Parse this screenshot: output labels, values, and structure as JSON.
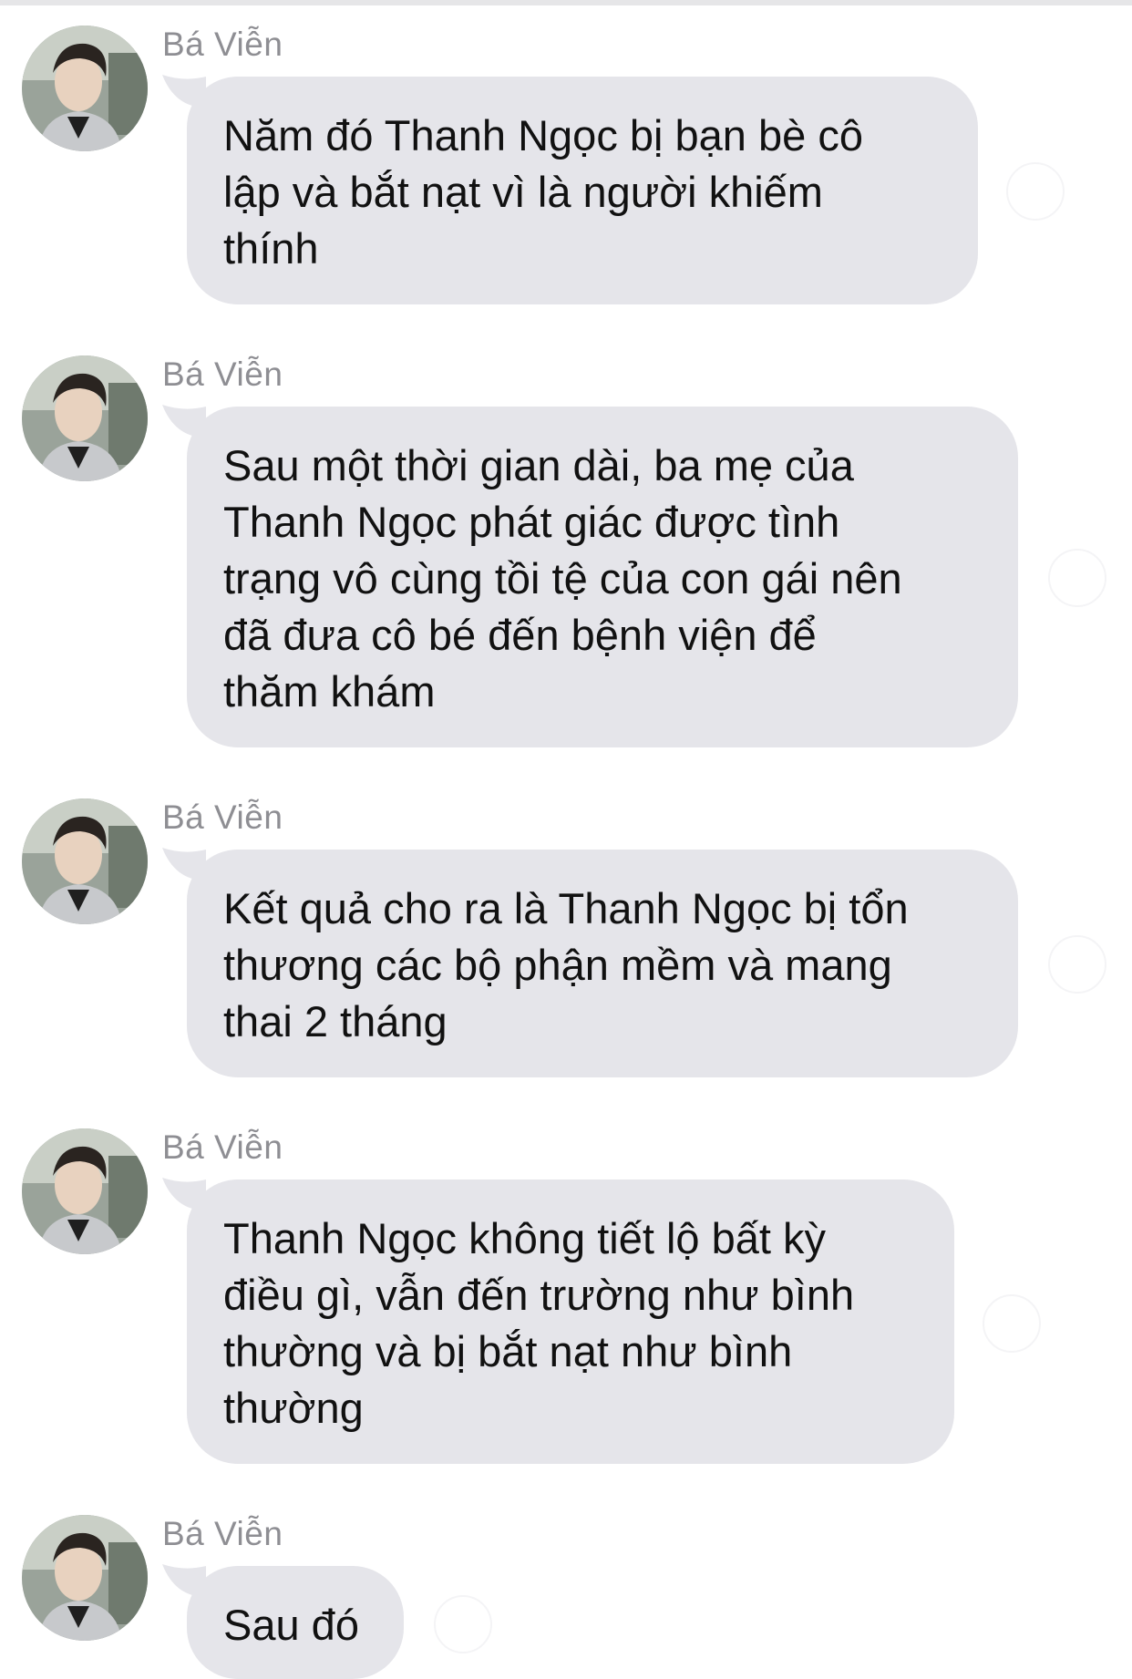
{
  "thread": {
    "messages": [
      {
        "sender": "Bá Viễn",
        "text": "Năm đó Thanh Ngọc bị bạn bè cô\nlập và bắt nạt vì là người khiếm\nthính"
      },
      {
        "sender": "Bá Viễn",
        "text": "Sau một thời gian dài, ba mẹ của\nThanh Ngọc phát giác được tình\ntrạng vô cùng tồi tệ của con gái nên\nđã đưa cô bé đến bệnh viện để\nthăm khám"
      },
      {
        "sender": "Bá Viễn",
        "text": "Kết quả cho ra là Thanh Ngọc bị tổn\nthương các bộ phận mềm và mang\nthai 2 tháng"
      },
      {
        "sender": "Bá Viễn",
        "text": "Thanh Ngọc không tiết lộ bất kỳ\nđiều gì, vẫn đến trường như bình\nthường và bị bắt nạt như bình\nthường"
      },
      {
        "sender": "Bá Viễn",
        "text": "Sau đó"
      }
    ]
  },
  "colors": {
    "bubble": "#e5e5ea",
    "sender_name": "#8e8e93",
    "text": "#111111",
    "background": "#ffffff"
  },
  "icons": {
    "avatar": "profile-photo"
  }
}
